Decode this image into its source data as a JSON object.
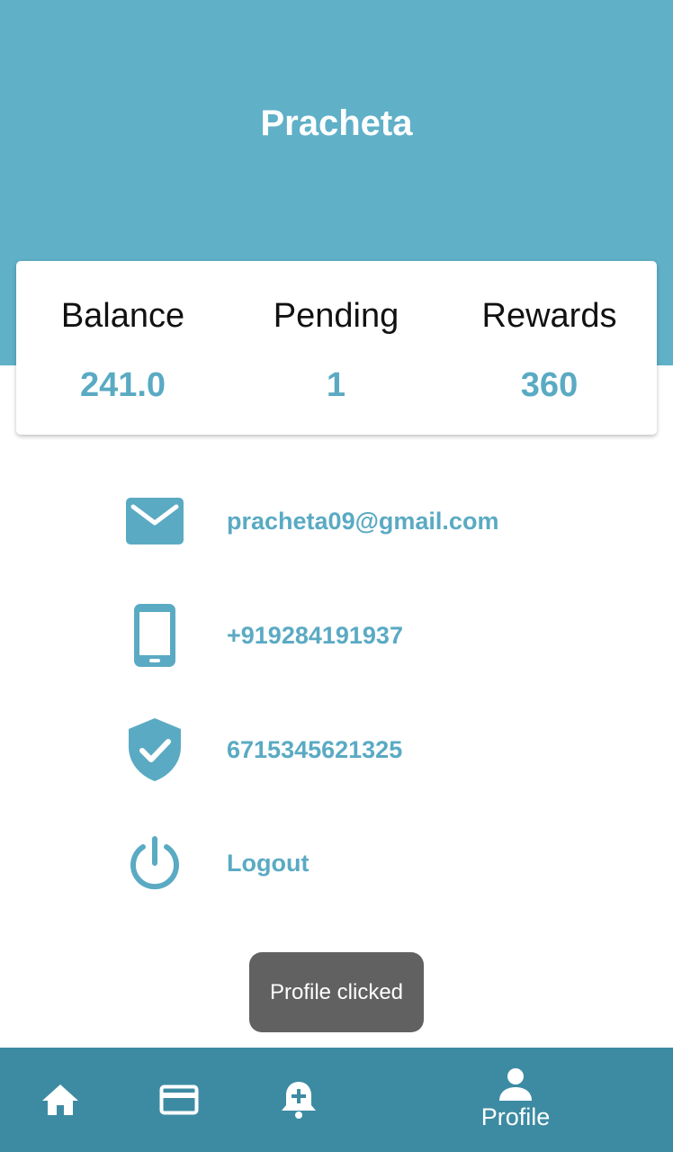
{
  "profile": {
    "name": "Pracheta"
  },
  "stats": [
    {
      "label": "Balance",
      "value": "241.0"
    },
    {
      "label": "Pending",
      "value": "1"
    },
    {
      "label": "Rewards",
      "value": "360"
    }
  ],
  "info": {
    "email": {
      "icon": "mail-icon",
      "text": "pracheta09@gmail.com"
    },
    "phone": {
      "icon": "phone-icon",
      "text": "+919284191937"
    },
    "id": {
      "icon": "verified-shield-icon",
      "text": "6715345621325"
    },
    "logout": {
      "icon": "power-icon",
      "text": "Logout"
    }
  },
  "toast": {
    "message": "Profile clicked"
  },
  "bottom_nav": {
    "items": [
      {
        "icon": "home-icon",
        "label": ""
      },
      {
        "icon": "card-icon",
        "label": ""
      },
      {
        "icon": "bell-plus-icon",
        "label": ""
      },
      {
        "icon": "person-icon",
        "label": "Profile",
        "active": true
      }
    ]
  },
  "colors": {
    "header": "#60b0c8",
    "accent": "#5aaac3",
    "nav_background": "#3d8ba3",
    "toast_background": "#616161"
  }
}
